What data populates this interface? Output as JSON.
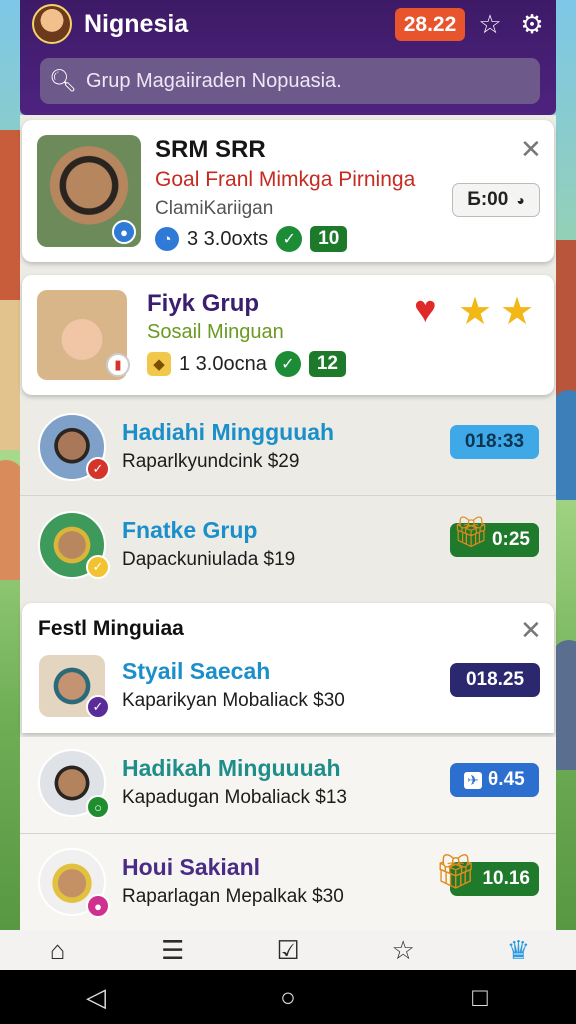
{
  "header": {
    "app_name": "Nignesia",
    "coin_count": "28.22",
    "star_icon": "star-outline-icon",
    "settings_icon": "gear-icon",
    "search_placeholder": "Grup Magaiiraden Nopuasia."
  },
  "top_cards": [
    {
      "title": "SRM SRR",
      "subtitle": "Goal Franl Mimkga Pirninga",
      "meta": "ClamiKariigan",
      "stat_text": "3 3.0oxts",
      "count": "10",
      "timer": "Б:00"
    },
    {
      "title": "Fiyk Grup",
      "subtitle": "Sosail Minguan",
      "stat_text": "1 3.0ocna",
      "count": "12"
    }
  ],
  "list_rows": [
    {
      "title": "Hadiahi Mingguuah",
      "subtitle": "Raparlkyundcink $29",
      "timer": "018:33",
      "title_color": "#1b8fc9",
      "timer_bg": "#3fa9e8",
      "timer_fg": "#0c3552"
    },
    {
      "title": "Fnatke Grup",
      "subtitle": "Dapackuniulada $19",
      "timer": "0:25",
      "title_color": "#1b8fc9",
      "timer_bg": "#1f7a2c",
      "timer_fg": "#ffffff"
    }
  ],
  "section": {
    "title": "Festl Minguiaa",
    "rows": [
      {
        "title": "Styail Saecah",
        "subtitle": "Kaparikyan Mobaliack $30",
        "timer": "018.25",
        "title_color": "#1b8fc9",
        "timer_bg": "#2b2870",
        "timer_fg": "#ffffff"
      },
      {
        "title": "Hadikah Minguuuah",
        "subtitle": "Kapadugan Mobaliack $13",
        "timer": "θ.45",
        "title_color": "#1f8e8a",
        "timer_bg": "#2c6fcf",
        "timer_fg": "#ffffff"
      },
      {
        "title": "Houi Sakianl",
        "subtitle": "Raparlagan Mepalkak $30",
        "timer": "10.16",
        "title_color": "#4a2b86",
        "timer_bg": "#1f7a2c",
        "timer_fg": "#ffffff"
      }
    ]
  },
  "bottom_nav": {
    "items": [
      "home-icon",
      "list-icon",
      "check-box-icon",
      "star-icon",
      "crown-icon"
    ]
  }
}
